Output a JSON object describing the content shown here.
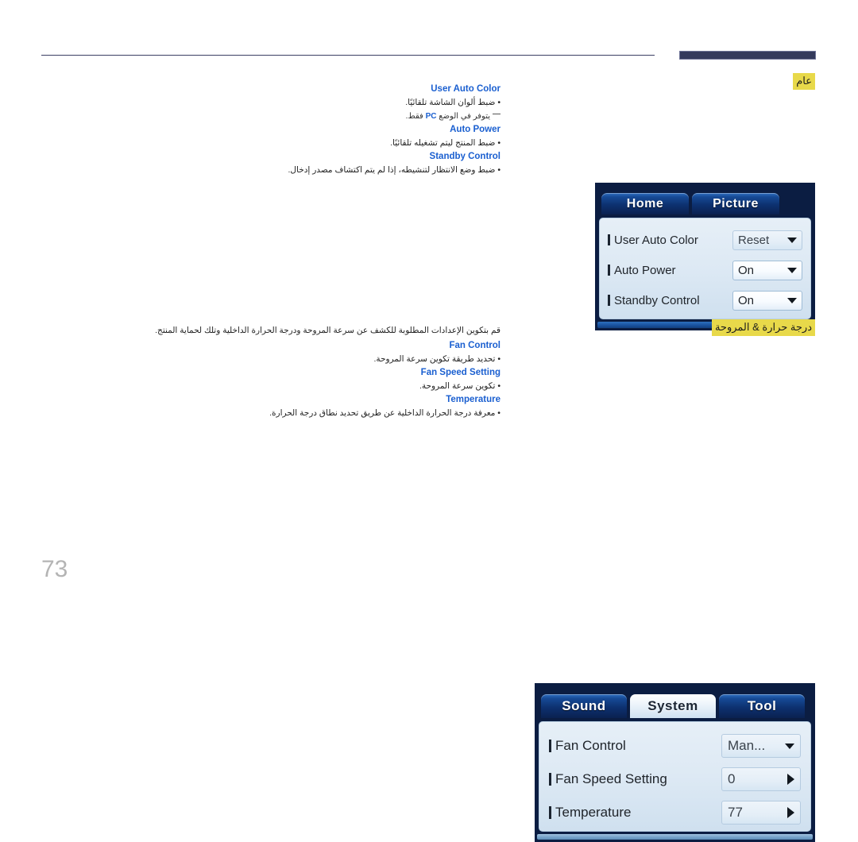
{
  "page": {
    "number": "73",
    "header_rule": true
  },
  "sections": [
    {
      "id": "general",
      "title_ar": "عام",
      "items": [
        {
          "heading": "User Auto Color",
          "bullets": [
            "• ضبط ألوان الشاشة تلقائيًا."
          ],
          "note_prefix": "يتوفر في الوضع ",
          "note_highlight": "PC",
          "note_suffix": " فقط."
        },
        {
          "heading": "Auto Power",
          "bullets": [
            "• ضبط المنتج ليتم تشغيله تلقائيًا."
          ]
        },
        {
          "heading": "Standby Control",
          "bullets": [
            "• ضبط وضع الانتظار لتنشيطه، إذا لم يتم اكتشاف مصدر إدخال."
          ]
        }
      ],
      "osd": {
        "tabs": [
          {
            "label": "Home",
            "active": false
          },
          {
            "label": "Picture",
            "active": false
          }
        ],
        "rows": [
          {
            "label": "User Auto Color",
            "value": "Reset",
            "control": "dropdown",
            "dim": true
          },
          {
            "label": "Auto Power",
            "value": "On",
            "control": "dropdown",
            "dim": false
          },
          {
            "label": "Standby Control",
            "value": "On",
            "control": "dropdown",
            "dim": false
          }
        ]
      }
    },
    {
      "id": "fan-temperature",
      "title_ar": "درجة حرارة & المروحة",
      "intro_ar": "قم بتكوين الإعدادات المطلوبة للكشف عن سرعة المروحة ودرجة الحرارة الداخلية وتلك لحماية المنتج.",
      "items": [
        {
          "heading": "Fan Control",
          "bullets": [
            "• تحديد طريقة تكوين سرعة المروحة."
          ]
        },
        {
          "heading": "Fan Speed Setting",
          "bullets": [
            "• تكوين سرعة المروحة."
          ]
        },
        {
          "heading": "Temperature",
          "bullets": [
            "• معرفة درجة الحرارة الداخلية عن طريق تحديد نطاق درجة الحرارة."
          ]
        }
      ],
      "osd": {
        "tabs": [
          {
            "label": "Sound",
            "active": false
          },
          {
            "label": "System",
            "active": true
          },
          {
            "label": "Tool",
            "active": false
          }
        ],
        "rows": [
          {
            "label": "Fan Control",
            "value": "Man...",
            "control": "dropdown",
            "dim": true
          },
          {
            "label": "Fan Speed Setting",
            "value": "0",
            "control": "stepper",
            "dim": true
          },
          {
            "label": "Temperature",
            "value": "77",
            "control": "stepper",
            "dim": true
          }
        ]
      }
    }
  ],
  "colors": {
    "heading_blue": "#1a5fd0",
    "highlight_yellow": "#e8d94a",
    "rule_navy": "#343a5c",
    "page_number_gray": "#b4b4b4"
  }
}
